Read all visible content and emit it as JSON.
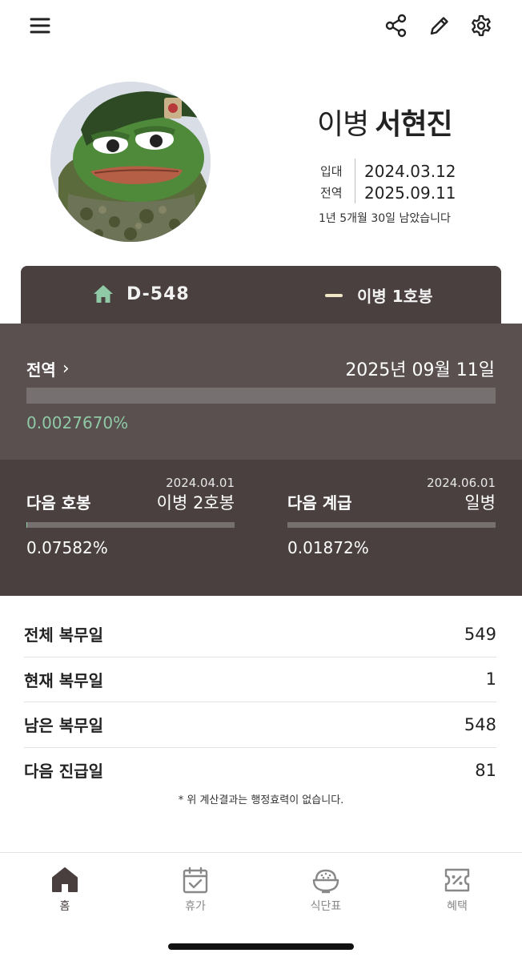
{
  "header": {
    "menu_icon": "menu-icon",
    "share_icon": "share-icon",
    "edit_icon": "pencil-icon",
    "settings_icon": "gear-icon"
  },
  "profile": {
    "rank": "이병",
    "name": "서현진",
    "enlist_label": "입대",
    "enlist_date": "2024.03.12",
    "discharge_label": "전역",
    "discharge_date": "2025.09.11",
    "remaining": "1년 5개월 30일 남았습니다"
  },
  "dday": {
    "home_icon": "home-icon",
    "dday_text": "D-548",
    "step_text": "이병 1호봉"
  },
  "discharge_progress": {
    "title": "전역",
    "date": "2025년 09월 11일",
    "percent_text": "0.0027670%",
    "fill_fraction": 2.77e-05
  },
  "next": {
    "pay_step": {
      "title": "다음 호봉",
      "date": "2024.04.01",
      "value": "이병 2호봉",
      "percent_text": "0.07582%",
      "fill_fraction": 0.0007582
    },
    "rank": {
      "title": "다음 계급",
      "date": "2024.06.01",
      "value": "일병",
      "percent_text": "0.01872%",
      "fill_fraction": 0.0001872
    }
  },
  "stats": [
    {
      "label": "전체 복무일",
      "value": "549"
    },
    {
      "label": "현재 복무일",
      "value": "1"
    },
    {
      "label": "남은 복무일",
      "value": "548"
    },
    {
      "label": "다음 진급일",
      "value": "81"
    }
  ],
  "note": "* 위 계산결과는 행정효력이 없습니다.",
  "nav": [
    {
      "label": "홈",
      "icon": "home-icon",
      "active": true
    },
    {
      "label": "휴가",
      "icon": "calendar-check-icon",
      "active": false
    },
    {
      "label": "식단표",
      "icon": "rice-bowl-icon",
      "active": false
    },
    {
      "label": "혜택",
      "icon": "ticket-percent-icon",
      "active": false
    }
  ],
  "colors": {
    "dark": "#4a4040",
    "mid": "#5a5050",
    "accent_green": "#8fc9a5",
    "dash_cream": "#f1e6c6"
  }
}
